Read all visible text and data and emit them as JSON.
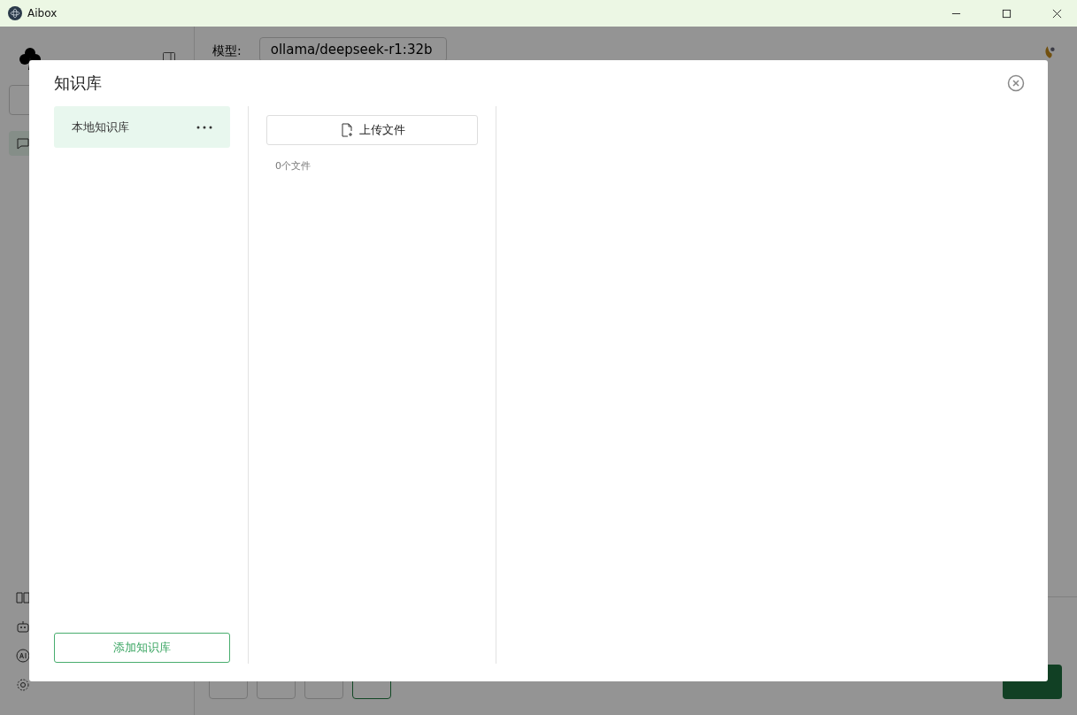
{
  "window": {
    "title": "Aibox"
  },
  "header": {
    "model_label": "模型:",
    "model_value": "ollama/deepseek-r1:32b"
  },
  "composer": {
    "tools": [
      {
        "selected": false
      },
      {
        "selected": false
      },
      {
        "selected": false
      },
      {
        "selected": true
      }
    ]
  },
  "dialog": {
    "title": "知识库",
    "knowledge_bases": [
      {
        "name": "本地知识库",
        "selected": true
      }
    ],
    "add_button": "添加知识库",
    "upload_button": "上传文件",
    "file_count": "0个文件"
  }
}
